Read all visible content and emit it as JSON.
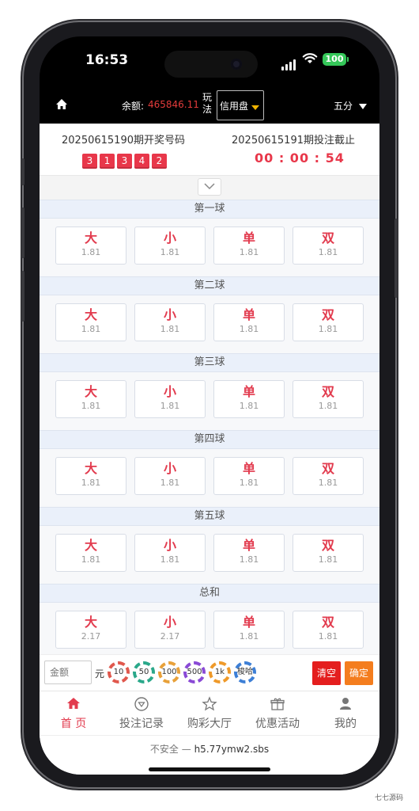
{
  "status": {
    "time": "16:53",
    "battery": "100"
  },
  "header": {
    "balance_label": "余额:",
    "balance_value": "465846.11",
    "play_label": "玩法",
    "mode": "信用盘",
    "period": "五分"
  },
  "draw": {
    "last_title": "20250615190期开奖号码",
    "last_numbers": [
      "3",
      "1",
      "3",
      "4",
      "2"
    ],
    "next_title": "20250615191期投注截止",
    "countdown": "00 : 00 : 54"
  },
  "sections": [
    {
      "title": "第一球",
      "options": [
        {
          "name": "大",
          "odds": "1.81"
        },
        {
          "name": "小",
          "odds": "1.81"
        },
        {
          "name": "单",
          "odds": "1.81"
        },
        {
          "name": "双",
          "odds": "1.81"
        }
      ]
    },
    {
      "title": "第二球",
      "options": [
        {
          "name": "大",
          "odds": "1.81"
        },
        {
          "name": "小",
          "odds": "1.81"
        },
        {
          "name": "单",
          "odds": "1.81"
        },
        {
          "name": "双",
          "odds": "1.81"
        }
      ]
    },
    {
      "title": "第三球",
      "options": [
        {
          "name": "大",
          "odds": "1.81"
        },
        {
          "name": "小",
          "odds": "1.81"
        },
        {
          "name": "单",
          "odds": "1.81"
        },
        {
          "name": "双",
          "odds": "1.81"
        }
      ]
    },
    {
      "title": "第四球",
      "options": [
        {
          "name": "大",
          "odds": "1.81"
        },
        {
          "name": "小",
          "odds": "1.81"
        },
        {
          "name": "单",
          "odds": "1.81"
        },
        {
          "name": "双",
          "odds": "1.81"
        }
      ]
    },
    {
      "title": "第五球",
      "options": [
        {
          "name": "大",
          "odds": "1.81"
        },
        {
          "name": "小",
          "odds": "1.81"
        },
        {
          "name": "单",
          "odds": "1.81"
        },
        {
          "name": "双",
          "odds": "1.81"
        }
      ]
    },
    {
      "title": "总和",
      "options": [
        {
          "name": "大",
          "odds": "2.17"
        },
        {
          "name": "小",
          "odds": "2.17"
        },
        {
          "name": "单",
          "odds": "1.81"
        },
        {
          "name": "双",
          "odds": "1.81"
        }
      ]
    }
  ],
  "bet_bar": {
    "amount_placeholder": "金额",
    "unit": "元",
    "chips": [
      "10",
      "50",
      "100",
      "500",
      "1k",
      "梭哈"
    ],
    "clear": "清空",
    "confirm": "确定"
  },
  "tabs": [
    {
      "label": "首 页",
      "icon": "home-icon"
    },
    {
      "label": "投注记录",
      "icon": "record-icon"
    },
    {
      "label": "购彩大厅",
      "icon": "lobby-icon"
    },
    {
      "label": "优惠活动",
      "icon": "gift-icon"
    },
    {
      "label": "我的",
      "icon": "user-icon"
    }
  ],
  "url_bar": {
    "insecure": "不安全 —",
    "host": "h5.77ymw2.sbs"
  },
  "watermark": "七七源码",
  "colors": {
    "accent_red": "#e23b4e",
    "balance_red": "#e33b3b",
    "clear_red": "#e41e1e",
    "confirm_orange": "#f47d1e",
    "battery_green": "#35c759",
    "section_bg": "#eaf0fa"
  }
}
